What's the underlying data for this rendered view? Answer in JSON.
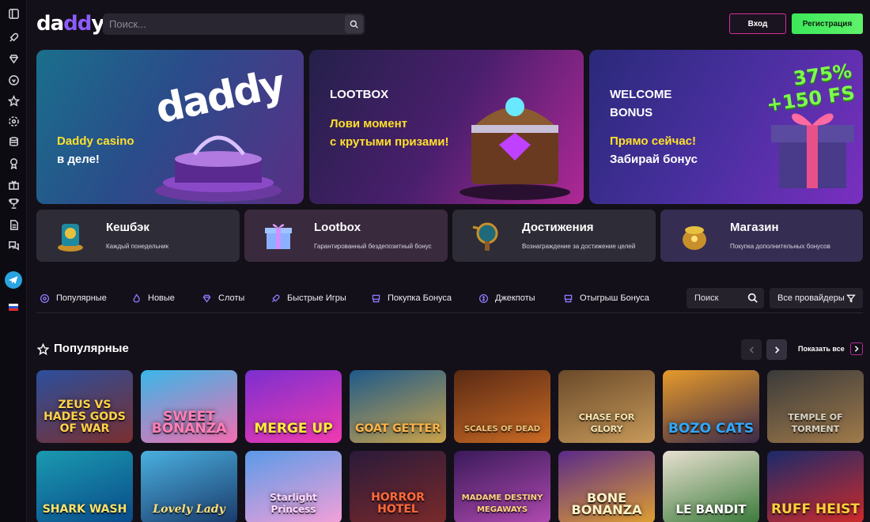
{
  "header": {
    "logo_text": "daddy",
    "search_placeholder": "Поиск...",
    "login_label": "Вход",
    "register_label": "Регистрация"
  },
  "banners": [
    {
      "title": "",
      "yellow": "Daddy casino",
      "white": "в деле!",
      "graphic_text": "daddy"
    },
    {
      "title": "LOOTBOX",
      "yellow": "Лови момент\nс крутыми призами!",
      "white": ""
    },
    {
      "title": "WELCOME\nBONUS",
      "yellow": "Прямо сейчас!",
      "white": "Забирай бонус",
      "graphic_text": "375%\n+150 FS"
    }
  ],
  "promos": [
    {
      "name": "Кешбэк",
      "subtitle": "Каждый понедельник"
    },
    {
      "name": "Lootbox",
      "subtitle": "Гарантированный бездепозитный бонус"
    },
    {
      "name": "Достижения",
      "subtitle": "Вознаграждение за достижение целей"
    },
    {
      "name": "Магазин",
      "subtitle": "Покупка дополнительных бонусов"
    }
  ],
  "categories": [
    {
      "label": "Популярные",
      "icon": "popular-icon"
    },
    {
      "label": "Новые",
      "icon": "fire-icon"
    },
    {
      "label": "Слоты",
      "icon": "diamond-icon"
    },
    {
      "label": "Быстрые Игры",
      "icon": "rocket-icon"
    },
    {
      "label": "Покупка Бонуса",
      "icon": "bonus-buy-icon"
    },
    {
      "label": "Джекпоты",
      "icon": "jackpot-icon"
    },
    {
      "label": "Отыгрыш Бонуса",
      "icon": "wager-icon"
    }
  ],
  "game_search_placeholder": "Поиск",
  "providers_label": "Все провайдеры",
  "section": {
    "title": "Популярные",
    "show_all": "Показать все"
  },
  "games": [
    {
      "name": "ZEUS VS HADES GODS OF WAR",
      "colors": [
        "#2b4f9c",
        "#7a2f30"
      ]
    },
    {
      "name": "SWEET BONANZA",
      "colors": [
        "#39b7e8",
        "#f46cb0"
      ]
    },
    {
      "name": "MERGE UP",
      "colors": [
        "#7b2fd0",
        "#f23ab0"
      ]
    },
    {
      "name": "GOAT GETTER",
      "colors": [
        "#1e5a8a",
        "#c9a24a"
      ]
    },
    {
      "name": "SCALES OF DEAD",
      "colors": [
        "#5a2a14",
        "#c96a24"
      ]
    },
    {
      "name": "CHASE FOR GLORY",
      "colors": [
        "#6a4a2a",
        "#c89a5a"
      ]
    },
    {
      "name": "BOZO CATS",
      "colors": [
        "#e69a2a",
        "#3a2a4a"
      ]
    },
    {
      "name": "TEMPLE OF TORMENT",
      "colors": [
        "#3a3a3a",
        "#a07a4a"
      ]
    },
    {
      "name": "SHARK WASH",
      "colors": [
        "#1a9ab0",
        "#0a4a8a"
      ]
    },
    {
      "name": "Lovely Lady",
      "colors": [
        "#4ab0e0",
        "#1a3a6a"
      ]
    },
    {
      "name": "Starlight Princess",
      "colors": [
        "#5a9ae8",
        "#f4a0d8"
      ]
    },
    {
      "name": "HORROR HOTEL",
      "colors": [
        "#2a1a3a",
        "#7a2a2a"
      ]
    },
    {
      "name": "MADAME DESTINY MEGAWAYS",
      "colors": [
        "#3a1a5a",
        "#b04ab0"
      ]
    },
    {
      "name": "BONE BONANZA",
      "colors": [
        "#5a2a8a",
        "#e0a030"
      ]
    },
    {
      "name": "LE BANDIT",
      "colors": [
        "#e8e0d0",
        "#3a7a3a"
      ]
    },
    {
      "name": "RUFF HEIST",
      "colors": [
        "#1a2a6a",
        "#d02a2a"
      ]
    }
  ],
  "sidebar": {
    "items": [
      "collapse-icon",
      "rocket-icon",
      "diamond-icon",
      "vip-icon",
      "star-icon",
      "hot-icon",
      "database-icon",
      "award-icon",
      "gift-icon",
      "trophy-icon",
      "document-icon",
      "chat-icon",
      "telegram-icon",
      "language-flag-icon"
    ]
  }
}
